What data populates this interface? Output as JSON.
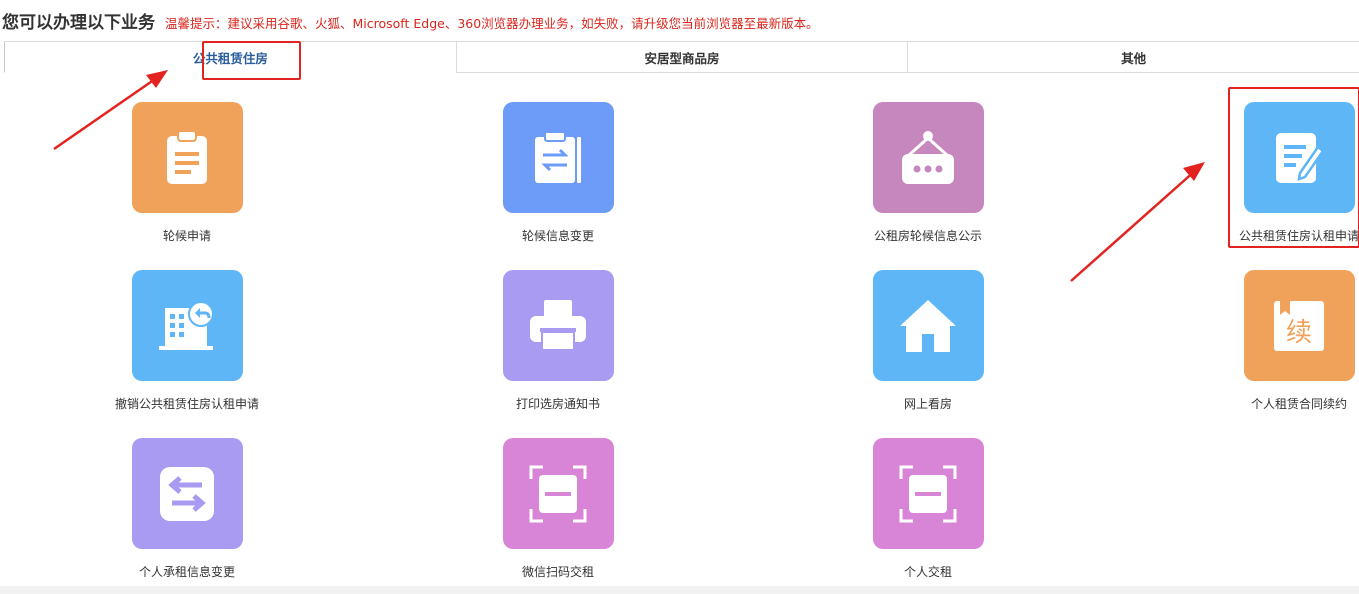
{
  "header": {
    "title": "您可以办理以下业务",
    "notice": "温馨提示：建议采用谷歌、火狐、Microsoft Edge、360浏览器办理业务，如失败，请升级您当前浏览器至最新版本。"
  },
  "tabs": [
    {
      "label": "公共租赁住房",
      "active": true
    },
    {
      "label": "安居型商品房",
      "active": false
    },
    {
      "label": "其他",
      "active": false
    }
  ],
  "colors": {
    "accent_red": "#e3231f",
    "orange": "#f0a25a",
    "blue": "#6d9cf8",
    "pink": "#c687be",
    "lightblue": "#5fb6f6",
    "lavender": "#a99af2",
    "magenta": "#d985d7"
  },
  "services": [
    {
      "label": "轮候申请",
      "icon": "clipboard-icon",
      "color": "#f0a25a"
    },
    {
      "label": "轮候信息变更",
      "icon": "exchange-document-icon",
      "color": "#6d9cf8"
    },
    {
      "label": "公租房轮候信息公示",
      "icon": "hanging-sign-icon",
      "color": "#c687be"
    },
    {
      "label": "公共租赁住房认租申请",
      "icon": "edit-document-icon",
      "color": "#5fb6f6"
    },
    {
      "label": "撤销公共租赁住房认租申请",
      "icon": "building-undo-icon",
      "color": "#5fb6f6"
    },
    {
      "label": "打印选房通知书",
      "icon": "printer-icon",
      "color": "#a99af2"
    },
    {
      "label": "网上看房",
      "icon": "house-icon",
      "color": "#5fb6f6"
    },
    {
      "label": "个人租赁合同续约",
      "icon": "renew-contract-icon",
      "color": "#f0a25a",
      "glyph": "续"
    },
    {
      "label": "个人承租信息变更",
      "icon": "swap-arrows-icon",
      "color": "#a99af2"
    },
    {
      "label": "微信扫码交租",
      "icon": "scan-icon",
      "color": "#d985d7"
    },
    {
      "label": "个人交租",
      "icon": "scan-icon",
      "color": "#d985d7"
    }
  ]
}
